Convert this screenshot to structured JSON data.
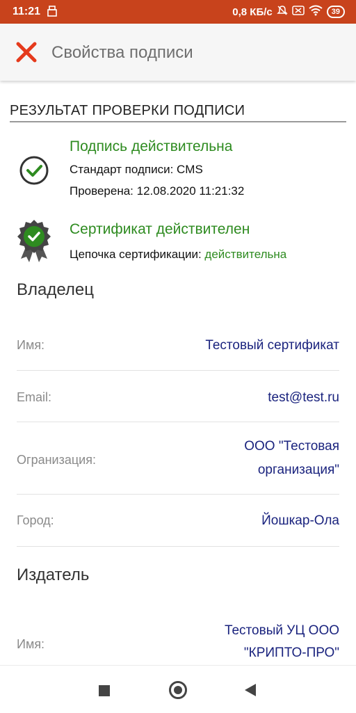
{
  "statusbar": {
    "time": "11:21",
    "speed": "0,8 КБ/с",
    "battery": "39"
  },
  "appbar": {
    "title": "Свойства подписи"
  },
  "result": {
    "header": "РЕЗУЛЬТАТ ПРОВЕРКИ ПОДПИСИ",
    "signature": {
      "title": "Подпись действительна",
      "standard": "Стандарт подписи: CMS",
      "checked": "Проверена: 12.08.2020 11:21:32"
    },
    "certificate": {
      "title": "Сертификат действителен",
      "chain_label": "Цепочка сертификации:",
      "chain_value": "действительна"
    }
  },
  "owner": {
    "title": "Владелец",
    "fields": [
      {
        "label": "Имя:",
        "value": "Тестовый сертификат"
      },
      {
        "label": "Email:",
        "value": "test@test.ru"
      },
      {
        "label": "Огранизация:",
        "value_line1": "ООО \"Тестовая",
        "value_line2": "организация\""
      },
      {
        "label": "Город:",
        "value": "Йошкар-Ола"
      }
    ]
  },
  "issuer": {
    "title": "Издатель",
    "fields": [
      {
        "label": "Имя:",
        "value_line1": "Тестовый УЦ ООО",
        "value_line2": "\"КРИПТО-ПРО\""
      }
    ]
  },
  "colors": {
    "statusbar": "#c8431c",
    "valid_green": "#2e8b20",
    "value_blue": "#1a237e",
    "close_red": "#e53a1c"
  }
}
